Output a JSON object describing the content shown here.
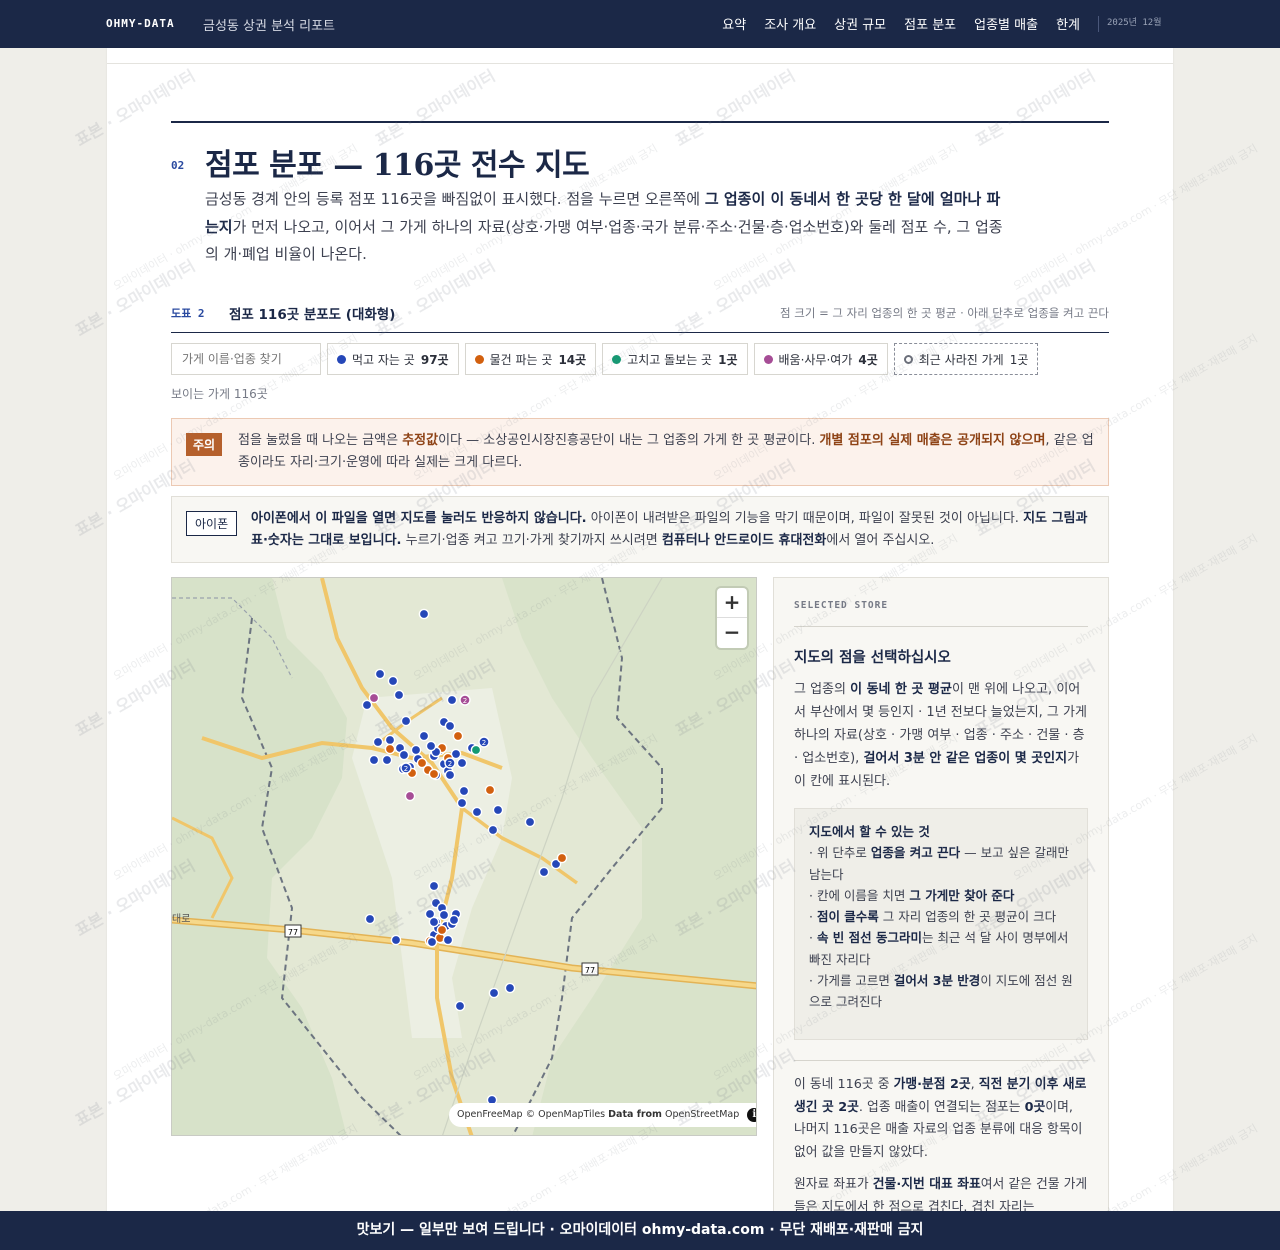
{
  "header": {
    "brand": "OHMY-DATA",
    "report_title": "금성동 상권 분석 리포트",
    "nav": [
      "요약",
      "조사 개요",
      "상권 규모",
      "점포 분포",
      "업종별 매출",
      "한계"
    ],
    "date": "2025년 12월"
  },
  "section": {
    "number": "02",
    "title": "점포 분포 — 116곳 전수 지도",
    "lead_1": "금성동 경계 안의 등록 점포 116곳을 빠짐없이 표시했다. 점을 누르면 오른쪽에 ",
    "lead_bold_1": "그 업종이 이 동네서 한 곳당 한 달에 얼마나 파는지",
    "lead_2": "가 먼저 나오고, 이어서 그 가게 하나의 자료(상호·가맹 여부·업종·국가 분류·주소·건물·층·업소번호)와 둘레 점포 수, 그 업종의 개·폐업 비율이 나온다."
  },
  "figure": {
    "label": "도표 2",
    "title": "점포 116곳 분포도 (대화형)",
    "note": "점 크기 = 그 자리 업종의 한 곳 평균 · 아래 단추로 업종을 켜고 끈다"
  },
  "controls": {
    "search_placeholder": "가게 이름·업종 찾기",
    "filters": [
      {
        "label": "먹고 자는 곳",
        "count": "97곳",
        "color": "#2547b8"
      },
      {
        "label": "물건 파는 곳",
        "count": "14곳",
        "color": "#d2600f"
      },
      {
        "label": "고치고 돌보는 곳",
        "count": "1곳",
        "color": "#139a73"
      },
      {
        "label": "배움·사무·여가",
        "count": "4곳",
        "color": "#a64d96"
      },
      {
        "label": "최근 사라진 가게",
        "count": "1곳",
        "color": "#6b6f7a"
      }
    ],
    "visible_count": "보이는 가게 116곳"
  },
  "warning": {
    "tag": "주의",
    "text_1": "점을 눌렀을 때 나오는 금액은 ",
    "bold_1": "추정값",
    "text_2": "이다 — 소상공인시장진흥공단이 내는 그 업종의 가게 한 곳 평균이다. ",
    "bold_2": "개별 점포의 실제 매출은 공개되지 않으며",
    "text_3": ", 같은 업종이라도 자리·크기·운영에 따라 실제는 크게 다르다."
  },
  "ios_note": {
    "tag": "아이폰",
    "bold_1": "아이폰에서 이 파일을 열면 지도를 눌러도 반응하지 않습니다.",
    "text_1": " 아이폰이 내려받은 파일의 기능을 막기 때문이며, 파일이 잘못된 것이 아닙니다. ",
    "bold_2": "지도 그림과 표·숫자는 그대로 보입니다.",
    "text_2": " 누르기·업종 켜고 끄기·가게 찾기까지 쓰시려면 ",
    "bold_3": "컴퓨터나 안드로이드 휴대전화",
    "text_3": "에서 열어 주십시오."
  },
  "map": {
    "zoom_in": "+",
    "zoom_out": "−",
    "road_shield": "77",
    "road_name": "대로",
    "attribution_1": "OpenFreeMap © OpenMapTiles ",
    "attribution_2": "Data from",
    "attribution_3": " OpenStreetMap",
    "info_icon": "i",
    "cluster_label": "2"
  },
  "panel": {
    "kicker": "SELECTED STORE",
    "title": "지도의 점을 선택하십시오",
    "desc_1": "그 업종의 ",
    "desc_b1": "이 동네 한 곳 평균",
    "desc_2": "이 맨 위에 나오고, 이어서 부산에서 몇 등인지 · 1년 전보다 늘었는지, 그 가게 하나의 자료(상호 · 가맹 여부 · 업종 · 주소 · 건물 · 층 · 업소번호), ",
    "desc_b2": "걸어서 3분 안 같은 업종이 몇 곳인지",
    "desc_3": "가 이 칸에 표시된다.",
    "help_title": "지도에서 할 수 있는 것",
    "help_1a": "· 위 단추로 ",
    "help_1b": "업종을 켜고 끈다",
    "help_1c": " — 보고 싶은 갈래만 남는다",
    "help_2a": "· 칸에 이름을 치면 ",
    "help_2b": "그 가게만 찾아 준다",
    "help_3a": "· ",
    "help_3b": "점이 클수록",
    "help_3c": " 그 자리 업종의 한 곳 평균이 크다",
    "help_4a": "· ",
    "help_4b": "속 빈 점선 동그라미",
    "help_4c": "는 최근 석 달 사이 명부에서 빠진 자리다",
    "help_5a": "· 가게를 고르면 ",
    "help_5b": "걸어서 3분 반경",
    "help_5c": "이 지도에 점선 원으로 그려진다",
    "stat_1": "이 동네 116곳 중 ",
    "stat_b1": "가맹·분점 2곳",
    "stat_2": ", ",
    "stat_b2": "직전 분기 이후 새로 생긴 곳 2곳",
    "stat_3": ". 업종 매출이 연결되는 점포는 ",
    "stat_b3": "0곳",
    "stat_4": "이며, 나머지 116곳은 매출 자료의 업종 분류에 대응 항목이 없어 값을 만들지 않았다.",
    "stat2_1": "원자료 좌표가 ",
    "stat2_b1": "건물·지번 대표 좌표",
    "stat2_2": "여서 같은 건물 가게들은 지도에서 한 점으로 겹친다. 겹친 자리는"
  },
  "footer": {
    "text": "맛보기 — 일부만 보여 드립니다 · 오마이데이터 ohmy-data.com · 무단 재배포·재판매 금지"
  },
  "watermark": {
    "big": "표본 · 오마이데이터",
    "small": "오마이데이터 · ohmy-data.com · 무단 재배포·재판매 금지"
  }
}
